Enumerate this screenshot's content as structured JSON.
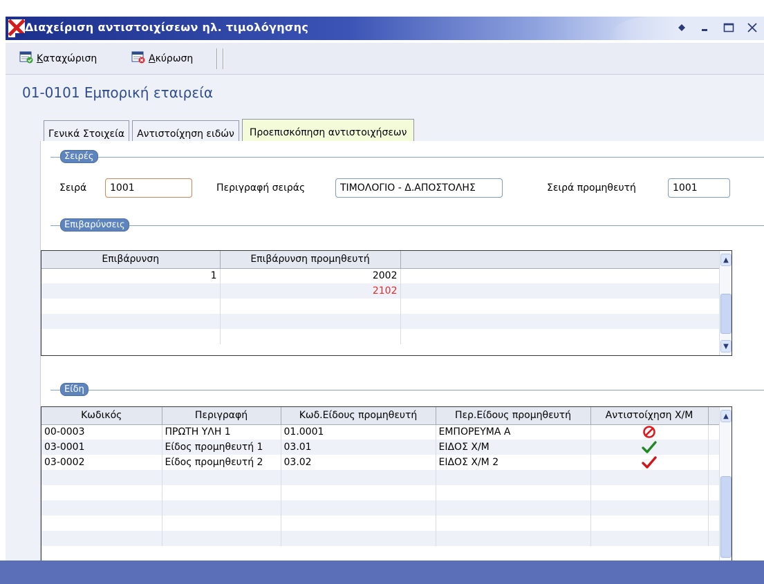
{
  "window": {
    "title": "Διαχείριση αντιστοιχίσεων ηλ. τιμολόγησης"
  },
  "toolbar": {
    "save_label": "Καταχώριση",
    "cancel_label": "Ακύρωση"
  },
  "company": "01-0101 Εμπορική εταιρεία",
  "tabs": [
    {
      "label": "Γενικά Στοιχεία"
    },
    {
      "label": "Αντιστοίχηση ειδών"
    },
    {
      "label": "Προεπισκόπηση αντιστοιχήσεων"
    }
  ],
  "series_group": {
    "title": "Σειρές",
    "series_label": "Σειρά",
    "series_value": "1001",
    "description_label": "Περιγραφή σειράς",
    "description_value": "ΤΙΜΟΛΟΓΙΟ - Δ.ΑΠΟΣΤΟΛΗΣ",
    "supplier_series_label": "Σειρά προμηθευτή",
    "supplier_series_value": "1001"
  },
  "charges_group": {
    "title": "Επιβαρύνσεις",
    "columns": [
      "Επιβάρυνση",
      "Επιβάρυνση προμηθευτή"
    ],
    "rows": [
      {
        "charge": "1",
        "supplier_charge": "2002"
      },
      {
        "charge": "",
        "supplier_charge": "2102"
      }
    ]
  },
  "items_group": {
    "title": "Είδη",
    "columns": [
      "Κωδικός",
      "Περιγραφή",
      "Κωδ.Είδους προμηθευτή",
      "Περ.Είδους προμηθευτή",
      "Αντιστοίχηση Χ/Μ"
    ],
    "rows": [
      {
        "code": "00-0003",
        "description": "ΠΡΩΤΗ ΥΛΗ 1",
        "supplier_code": "01.0001",
        "supplier_description": "ΕΜΠΟΡΕΥΜΑ Α",
        "status": "no-entry-icon"
      },
      {
        "code": "03-0001",
        "description": "Είδος προμηθευτή 1",
        "supplier_code": "03.01",
        "supplier_description": "ΕΙΔΟΣ Χ/Μ",
        "status": "green-check-icon"
      },
      {
        "code": "03-0002",
        "description": "Είδος προμηθευτή 2",
        "supplier_code": "03.02",
        "supplier_description": "ΕΙΔΟΣ Χ/Μ 2",
        "status": "red-check-icon"
      }
    ]
  },
  "colors": {
    "titlebar": "#1c2f8c",
    "company_text": "#2f4c8e",
    "group_label_bg": "#5e84bd",
    "active_tab_bg": "#f3fbd8",
    "highlight_red": "#e22b2b",
    "statusbar": "#5b6fb9"
  }
}
